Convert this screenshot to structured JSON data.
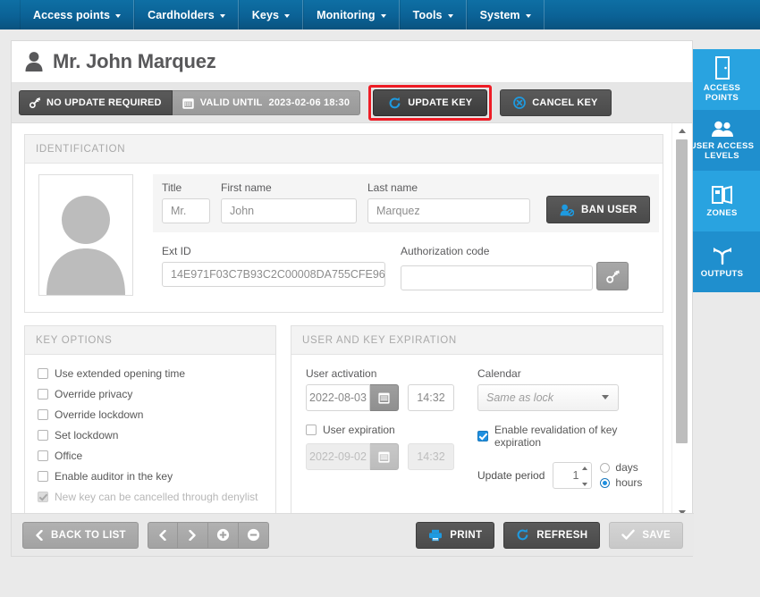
{
  "nav": {
    "items": [
      {
        "label": "Access points",
        "icon": "chevron-down-icon"
      },
      {
        "label": "Cardholders",
        "icon": "chevron-down-icon"
      },
      {
        "label": "Keys",
        "icon": "chevron-down-icon"
      },
      {
        "label": "Monitoring",
        "icon": "chevron-down-icon"
      },
      {
        "label": "Tools",
        "icon": "chevron-down-icon"
      },
      {
        "label": "System",
        "icon": "chevron-down-icon"
      }
    ]
  },
  "header": {
    "title": "Mr. John Marquez",
    "avatar_icon": "person-icon"
  },
  "status_bar": {
    "no_update_required": {
      "label": "NO UPDATE REQUIRED",
      "icon": "key-icon"
    },
    "valid_until": {
      "label": "VALID UNTIL",
      "value": "2023-02-06 18:30",
      "icon": "calendar-icon"
    },
    "update_key": {
      "label": "UPDATE KEY",
      "icon": "refresh-icon",
      "highlight_color": "#ee1c25"
    },
    "cancel_key": {
      "label": "CANCEL KEY",
      "icon": "cancel-circle-icon"
    }
  },
  "identification": {
    "panel_title": "IDENTIFICATION",
    "photo_icon": "user-photo-placeholder",
    "title": {
      "label": "Title",
      "value": "Mr."
    },
    "first_name": {
      "label": "First name",
      "value": "John"
    },
    "last_name": {
      "label": "Last name",
      "value": "Marquez"
    },
    "ban_user": {
      "label": "BAN USER",
      "icon": "ban-user-icon"
    },
    "ext_id": {
      "label": "Ext ID",
      "value": "14E971F03C7B93C2C00008DA755CFE96"
    },
    "authorization_code": {
      "label": "Authorization code",
      "value": "",
      "button_icon": "key-icon"
    }
  },
  "key_options": {
    "panel_title": "KEY OPTIONS",
    "items": [
      {
        "label": "Use extended opening time",
        "checked": false,
        "disabled": false
      },
      {
        "label": "Override privacy",
        "checked": false,
        "disabled": false
      },
      {
        "label": "Override lockdown",
        "checked": false,
        "disabled": false
      },
      {
        "label": "Set lockdown",
        "checked": false,
        "disabled": false
      },
      {
        "label": "Office",
        "checked": false,
        "disabled": false
      },
      {
        "label": "Enable auditor in the key",
        "checked": false,
        "disabled": false
      },
      {
        "label": "New key can be cancelled through denylist",
        "checked": true,
        "disabled": true
      }
    ]
  },
  "expiration": {
    "panel_title": "USER AND KEY EXPIRATION",
    "user_activation": {
      "label": "User activation",
      "date": "2022-08-03",
      "time": "14:32",
      "calendar_icon": "calendar-icon"
    },
    "calendar": {
      "label": "Calendar",
      "selected": "Same as lock",
      "caret_icon": "chevron-down-icon"
    },
    "user_expiration": {
      "label": "User expiration",
      "checked": false,
      "date": "2022-09-02",
      "time": "14:32",
      "calendar_icon": "calendar-icon"
    },
    "revalidation": {
      "label": "Enable revalidation of key expiration",
      "checked": true
    },
    "update_period": {
      "label": "Update period",
      "value": "1",
      "unit_options": [
        {
          "label": "days",
          "selected": false
        },
        {
          "label": "hours",
          "selected": true
        }
      ]
    }
  },
  "scrollbar": {
    "up_icon": "triangle-up-icon",
    "down_icon": "triangle-down-icon"
  },
  "bottom_bar": {
    "back_to_list": {
      "label": "BACK TO LIST",
      "icon": "chevron-left-icon"
    },
    "prev": {
      "icon": "chevron-left-icon"
    },
    "next": {
      "icon": "chevron-right-icon"
    },
    "add": {
      "icon": "plus-circle-icon"
    },
    "remove": {
      "icon": "minus-circle-icon"
    },
    "print": {
      "label": "PRINT",
      "icon": "printer-icon"
    },
    "refresh": {
      "label": "REFRESH",
      "icon": "refresh-icon"
    },
    "save": {
      "label": "SAVE",
      "icon": "check-icon",
      "disabled": true
    }
  },
  "side_tiles": [
    {
      "label": "ACCESS POINTS",
      "icon": "door-icon",
      "shade": "light"
    },
    {
      "label": "USER ACCESS LEVELS",
      "icon": "users-icon",
      "shade": "dark"
    },
    {
      "label": "ZONES",
      "icon": "zones-icon",
      "shade": "light"
    },
    {
      "label": "OUTPUTS",
      "icon": "outputs-icon",
      "shade": "dark"
    }
  ],
  "colors": {
    "nav_blue": "#0b6296",
    "tile_light": "#29a3e0",
    "tile_dark": "#1f8fce",
    "accent_blue": "#1e8fe0",
    "highlight_red": "#ee1c25"
  }
}
